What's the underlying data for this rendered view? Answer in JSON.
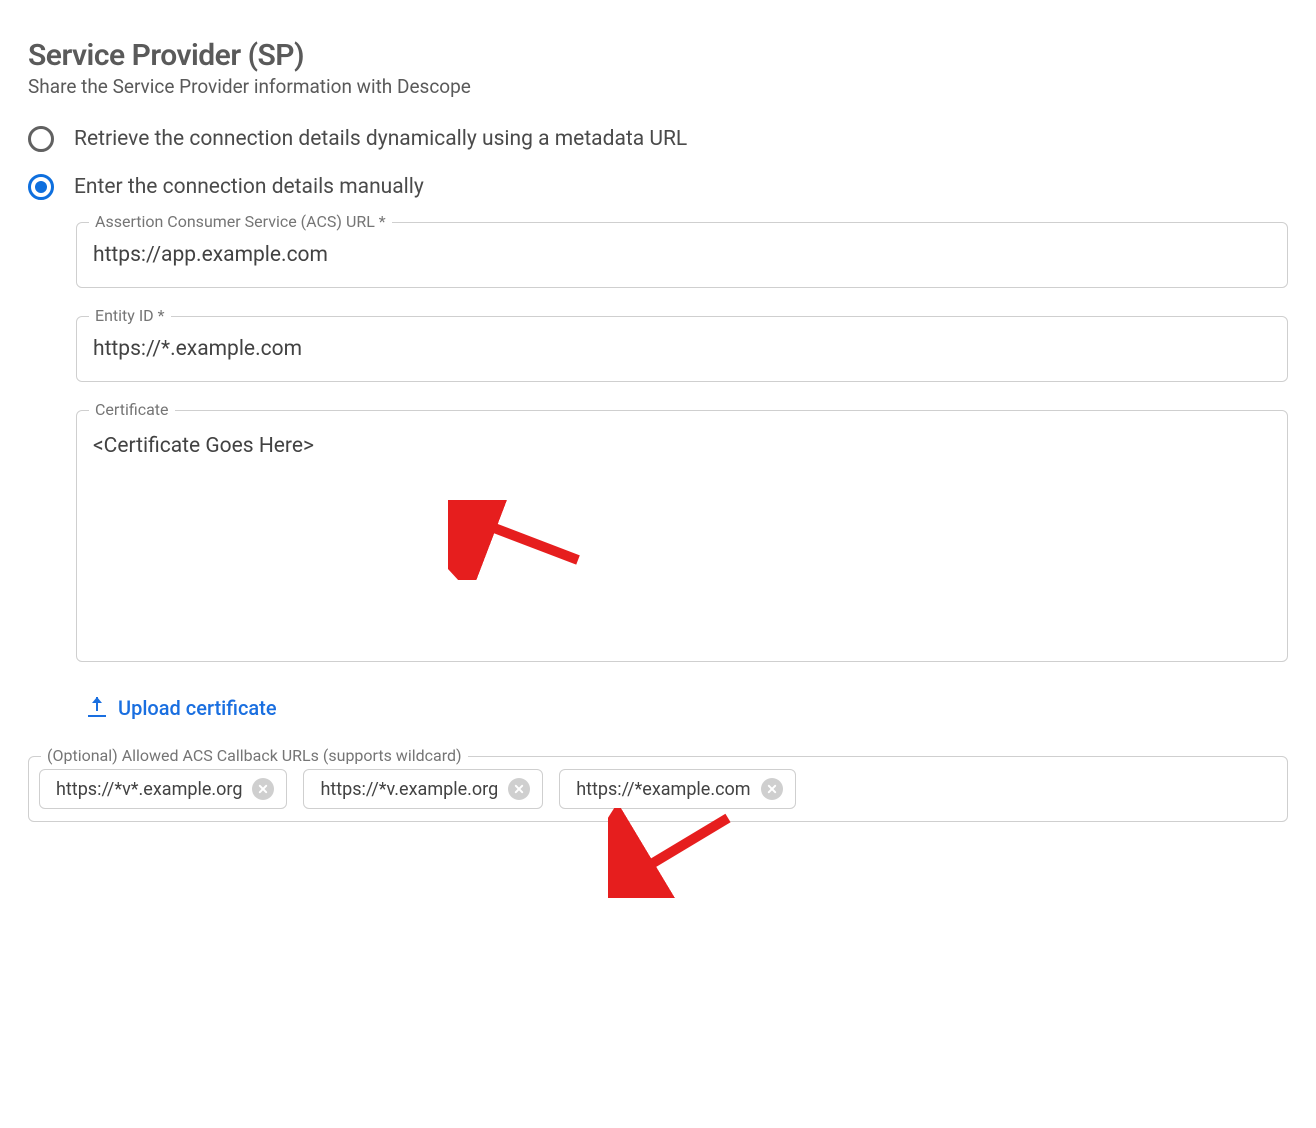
{
  "header": {
    "title": "Service Provider (SP)",
    "subtitle": "Share the Service Provider information with Descope"
  },
  "options": {
    "metadata": "Retrieve the connection details dynamically using a metadata URL",
    "manual": "Enter the connection details manually"
  },
  "fields": {
    "acs": {
      "label": "Assertion Consumer Service (ACS) URL *",
      "value": "https://app.example.com"
    },
    "entity": {
      "label": "Entity ID *",
      "value": "https://*.example.com"
    },
    "cert": {
      "label": "Certificate",
      "value": "<Certificate Goes Here>"
    },
    "upload_label": "Upload certificate",
    "callbacks": {
      "label": "(Optional) Allowed ACS Callback URLs (supports wildcard)",
      "items": [
        "https://*v*.example.org",
        "https://*v.example.org",
        "https://*example.com"
      ]
    }
  }
}
